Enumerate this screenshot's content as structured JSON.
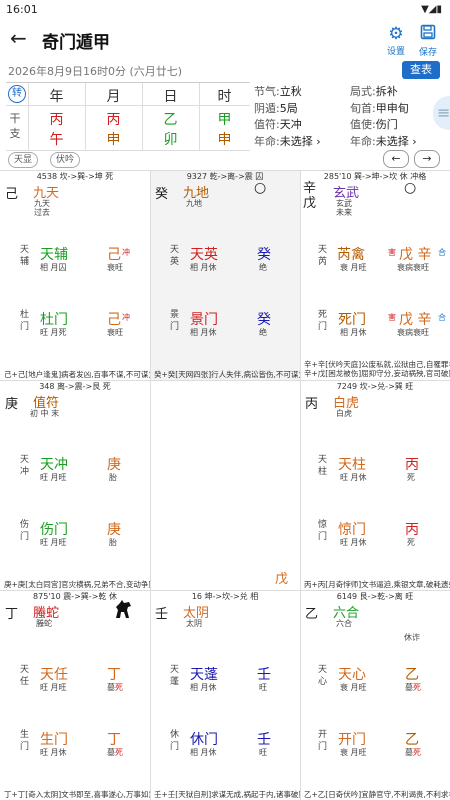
{
  "status_bar": {
    "time": "16:01",
    "icons": "▼◢▮"
  },
  "app": {
    "title": "奇门遁甲",
    "settings_label": "设置",
    "save_label": "保存"
  },
  "date_line": "2026年8月9日16时0分 (六月廿七)",
  "query_label": "查表",
  "pillars": {
    "zhuan": "转",
    "headers": [
      "年",
      "月",
      "日",
      "时"
    ],
    "side": "干\n支",
    "gan": [
      "丙",
      "丙",
      "乙",
      "甲"
    ],
    "zhi": [
      "午",
      "申",
      "卯",
      "申"
    ]
  },
  "info": {
    "left": [
      {
        "k": "节气:",
        "v": "立秋"
      },
      {
        "k": "阴遁:",
        "v": "5局"
      },
      {
        "k": "值符:",
        "v": "天冲"
      },
      {
        "k": "年命:",
        "v": "未选择 ›"
      }
    ],
    "right": [
      {
        "k": "局式:",
        "v": "拆补"
      },
      {
        "k": "旬首:",
        "v": "甲申旬"
      },
      {
        "k": "值使:",
        "v": "伤门"
      },
      {
        "k": "年命:",
        "v": "未选择 ›"
      }
    ]
  },
  "tags": [
    "天显",
    "伏吟"
  ],
  "nav": {
    "prev": "←",
    "next": "→"
  },
  "palaces": [
    {
      "header": "4538 坎->巽->坤 死",
      "left_stem": "己",
      "god": "九天",
      "god_sub1": "九天",
      "god_sub2": "过去",
      "star_v": "天\n辅",
      "star": "天辅",
      "star_sub": "相 月囚",
      "tstem": "己",
      "tstem_mark": "冲",
      "tstem_sub": "衰旺",
      "door_v": "杜\n门",
      "door": "杜门",
      "door_sub": "旺 月死",
      "dstem": "己",
      "dstem_mark": "冲",
      "dstem_sub": "衰旺",
      "foot": "己+己[地户逢鬼]病者发凶,百事不谋,不可谋为",
      "circle": ""
    },
    {
      "header": "9327 乾->离->震 囚",
      "left_stem": "癸",
      "god": "九地",
      "god_sub1": "九地",
      "god_sub2": "",
      "star_v": "天\n英",
      "star": "天英",
      "star_sub": "相 月休",
      "tstem": "癸",
      "tstem_mark": "",
      "tstem_sub": "绝",
      "door_v": "景\n门",
      "door": "景门",
      "door_sub": "相 月休",
      "dstem": "癸",
      "dstem_mark": "",
      "dstem_sub": "绝",
      "foot": "癸+癸[天网四张]行人失伴,病讼皆伤,不可谋为",
      "circle": "○"
    },
    {
      "header": "285'10 巽->坤->坎 休 冲格",
      "left_stem": "辛\n戊",
      "god": "玄武",
      "god_sub1": "玄武",
      "god_sub2": "未来",
      "star_v": "天\n芮",
      "star": "芮禽",
      "star_sub": "衰 月旺",
      "tstem": "戊 辛",
      "tstem_mark": "害 合",
      "tstem_sub": "衰病衰旺",
      "door_v": "死\n门",
      "door": "死门",
      "door_sub": "相 月休",
      "dstem": "戊 辛",
      "dstem_mark": "害 合",
      "dstem_sub": "衰病衰旺",
      "foot": "辛+辛[伏吟天庭]公废私就,讼狱由己,自罹罪名\n辛+戊[困龙被伤]屈抑守分,妄动祸殃,官司破财",
      "circle": "○"
    },
    {
      "header": "348 离->震->艮 死",
      "left_stem": "庚",
      "god": "值符",
      "god_sub1": "初 中 末",
      "star_v": "天\n冲",
      "star": "天冲",
      "star_sub": "旺 月旺",
      "tstem": "庚",
      "tstem_mark": "",
      "tstem_sub": "胎",
      "door_v": "伤\n门",
      "door": "伤门",
      "door_sub": "旺 月旺",
      "dstem": "庚",
      "dstem_mark": "",
      "dstem_sub": "胎",
      "foot": "庚+庚[太白同宫]官灾横祸,兄弟不合,变动争财"
    },
    {
      "center_stem": "戊"
    },
    {
      "header": "7249 坎->兑->巽 旺",
      "left_stem": "丙",
      "god": "白虎",
      "god_sub1": "白虎",
      "star_v": "天\n柱",
      "star": "天柱",
      "star_sub": "旺 月休",
      "tstem": "丙",
      "tstem_mark": "",
      "tstem_sub": "死",
      "door_v": "惊\n门",
      "door": "惊门",
      "door_sub": "旺 月休",
      "dstem": "丙",
      "dstem_mark": "",
      "dstem_sub": "死",
      "foot": "丙+丙[月奇悖师]文书逼迫,乘银文章,破耗遗失"
    },
    {
      "header": "875'10 震->巽->乾 休",
      "left_stem": "丁",
      "god": "螣蛇",
      "god_sub1": "螣蛇",
      "star_v": "天\n任",
      "star": "天任",
      "star_sub": "旺 月旺",
      "tstem": "丁",
      "tstem_mark": "",
      "tstem_sub": "墓死",
      "door_v": "生\n门",
      "door": "生门",
      "door_sub": "旺 月休",
      "dstem": "丁",
      "dstem_mark": "",
      "dstem_sub": "墓死",
      "foot": "丁+丁[奇入太阴]文书即至,喜事遂心,万事如意"
    },
    {
      "header": "16 坤->坎->兑 相",
      "left_stem": "壬",
      "god": "太阴",
      "god_sub1": "太阴",
      "star_v": "天\n蓬",
      "star": "天蓬",
      "star_sub": "相 月休",
      "tstem": "壬",
      "tstem_mark": "",
      "tstem_sub": "旺",
      "door_v": "休\n门",
      "door": "休门",
      "door_sub": "相 月休",
      "dstem": "壬",
      "dstem_mark": "",
      "dstem_sub": "旺",
      "foot": "壬+壬[天狱自刑]求谋无成,祸起于内,诸事破败"
    },
    {
      "header": "6149 艮->乾->离 旺",
      "left_stem": "乙",
      "god": "六合",
      "god_sub1": "六合",
      "extra": "休诈",
      "star_v": "天\n心",
      "star": "天心",
      "star_sub": "衰 月旺",
      "tstem": "乙",
      "tstem_mark": "",
      "tstem_sub": "墓死",
      "door_v": "开\n门",
      "door": "开门",
      "door_sub": "衰 月旺",
      "dstem": "乙",
      "dstem_mark": "",
      "dstem_sub": "墓死",
      "foot": "乙+乙[日奇伏吟]宜静官守,不利谒贵,不利求名"
    }
  ]
}
